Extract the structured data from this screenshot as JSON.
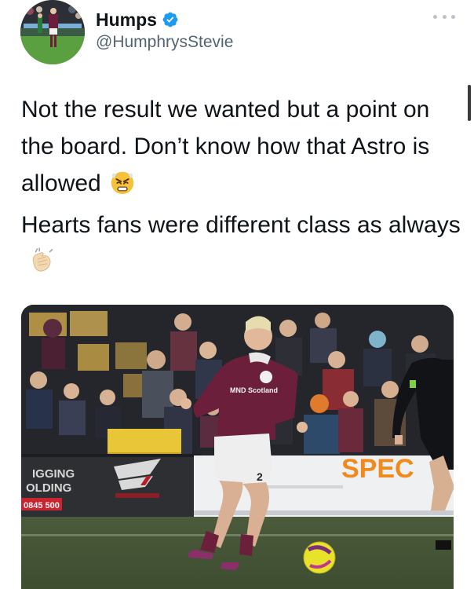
{
  "author": {
    "display_name": "Humps",
    "handle": "@HumphrysStevie",
    "verified_icon": "verified-badge-icon",
    "avatar_icon": "avatar-photo",
    "more_icon": "more-options-icon"
  },
  "tweet": {
    "line1": "Not the result we wanted but a point on the board. Don’t know how that Astro is allowed",
    "emoji1": "steaming-angry-face-emoji",
    "line2": "Hearts fans were different class as always",
    "emoji2": "clapping-hands-emoji"
  },
  "media": {
    "shirt_sponsor": "MND Scotland",
    "board_left_1": "IGGING",
    "board_left_2": "OLDING",
    "board_left_3": "0845 500",
    "board_right": "SPEC",
    "shorts_number": "2"
  },
  "colors": {
    "verified": "#1d9bf0",
    "text": "#0f1419",
    "secondary": "#536471",
    "hearts_maroon": "#6b1f3a",
    "sponsor_orange": "#f08a1c"
  }
}
